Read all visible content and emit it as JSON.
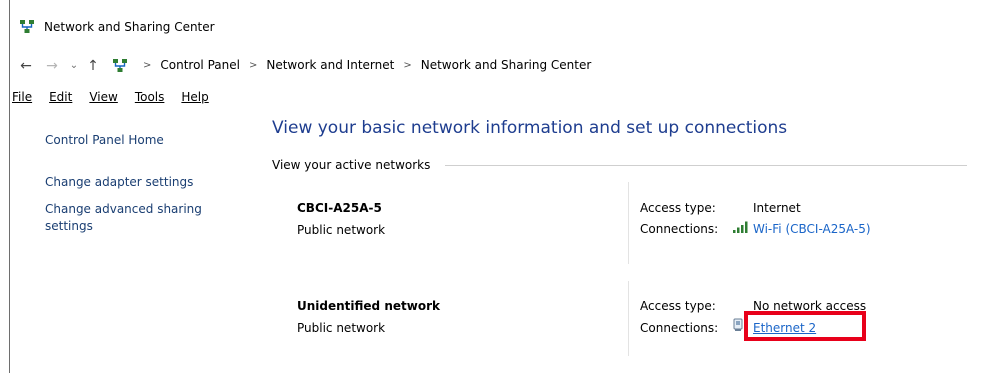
{
  "window": {
    "title": "Network and Sharing Center"
  },
  "address": {
    "crumbs": [
      "Control Panel",
      "Network and Internet",
      "Network and Sharing Center"
    ]
  },
  "menu": [
    "File",
    "Edit",
    "View",
    "Tools",
    "Help"
  ],
  "sidebar": {
    "home": "Control Panel Home",
    "adapter": "Change adapter settings",
    "sharing": "Change advanced sharing settings"
  },
  "main": {
    "title": "View your basic network information and set up connections",
    "active_label": "View your active networks",
    "networks": [
      {
        "name": "CBCI-A25A-5",
        "type": "Public network",
        "access_label": "Access type:",
        "access_value": "Internet",
        "conn_label": "Connections:",
        "conn_value": "Wi-Fi (CBCI-A25A-5)",
        "conn_icon": "wifi-signal-icon"
      },
      {
        "name": "Unidentified network",
        "type": "Public network",
        "access_label": "Access type:",
        "access_value": "No network access",
        "conn_label": "Connections:",
        "conn_value": "Ethernet 2",
        "conn_icon": "ethernet-icon"
      }
    ]
  },
  "colors": {
    "link": "#1a65c8",
    "title": "#1e3d8f",
    "highlight": "#e8001a"
  }
}
